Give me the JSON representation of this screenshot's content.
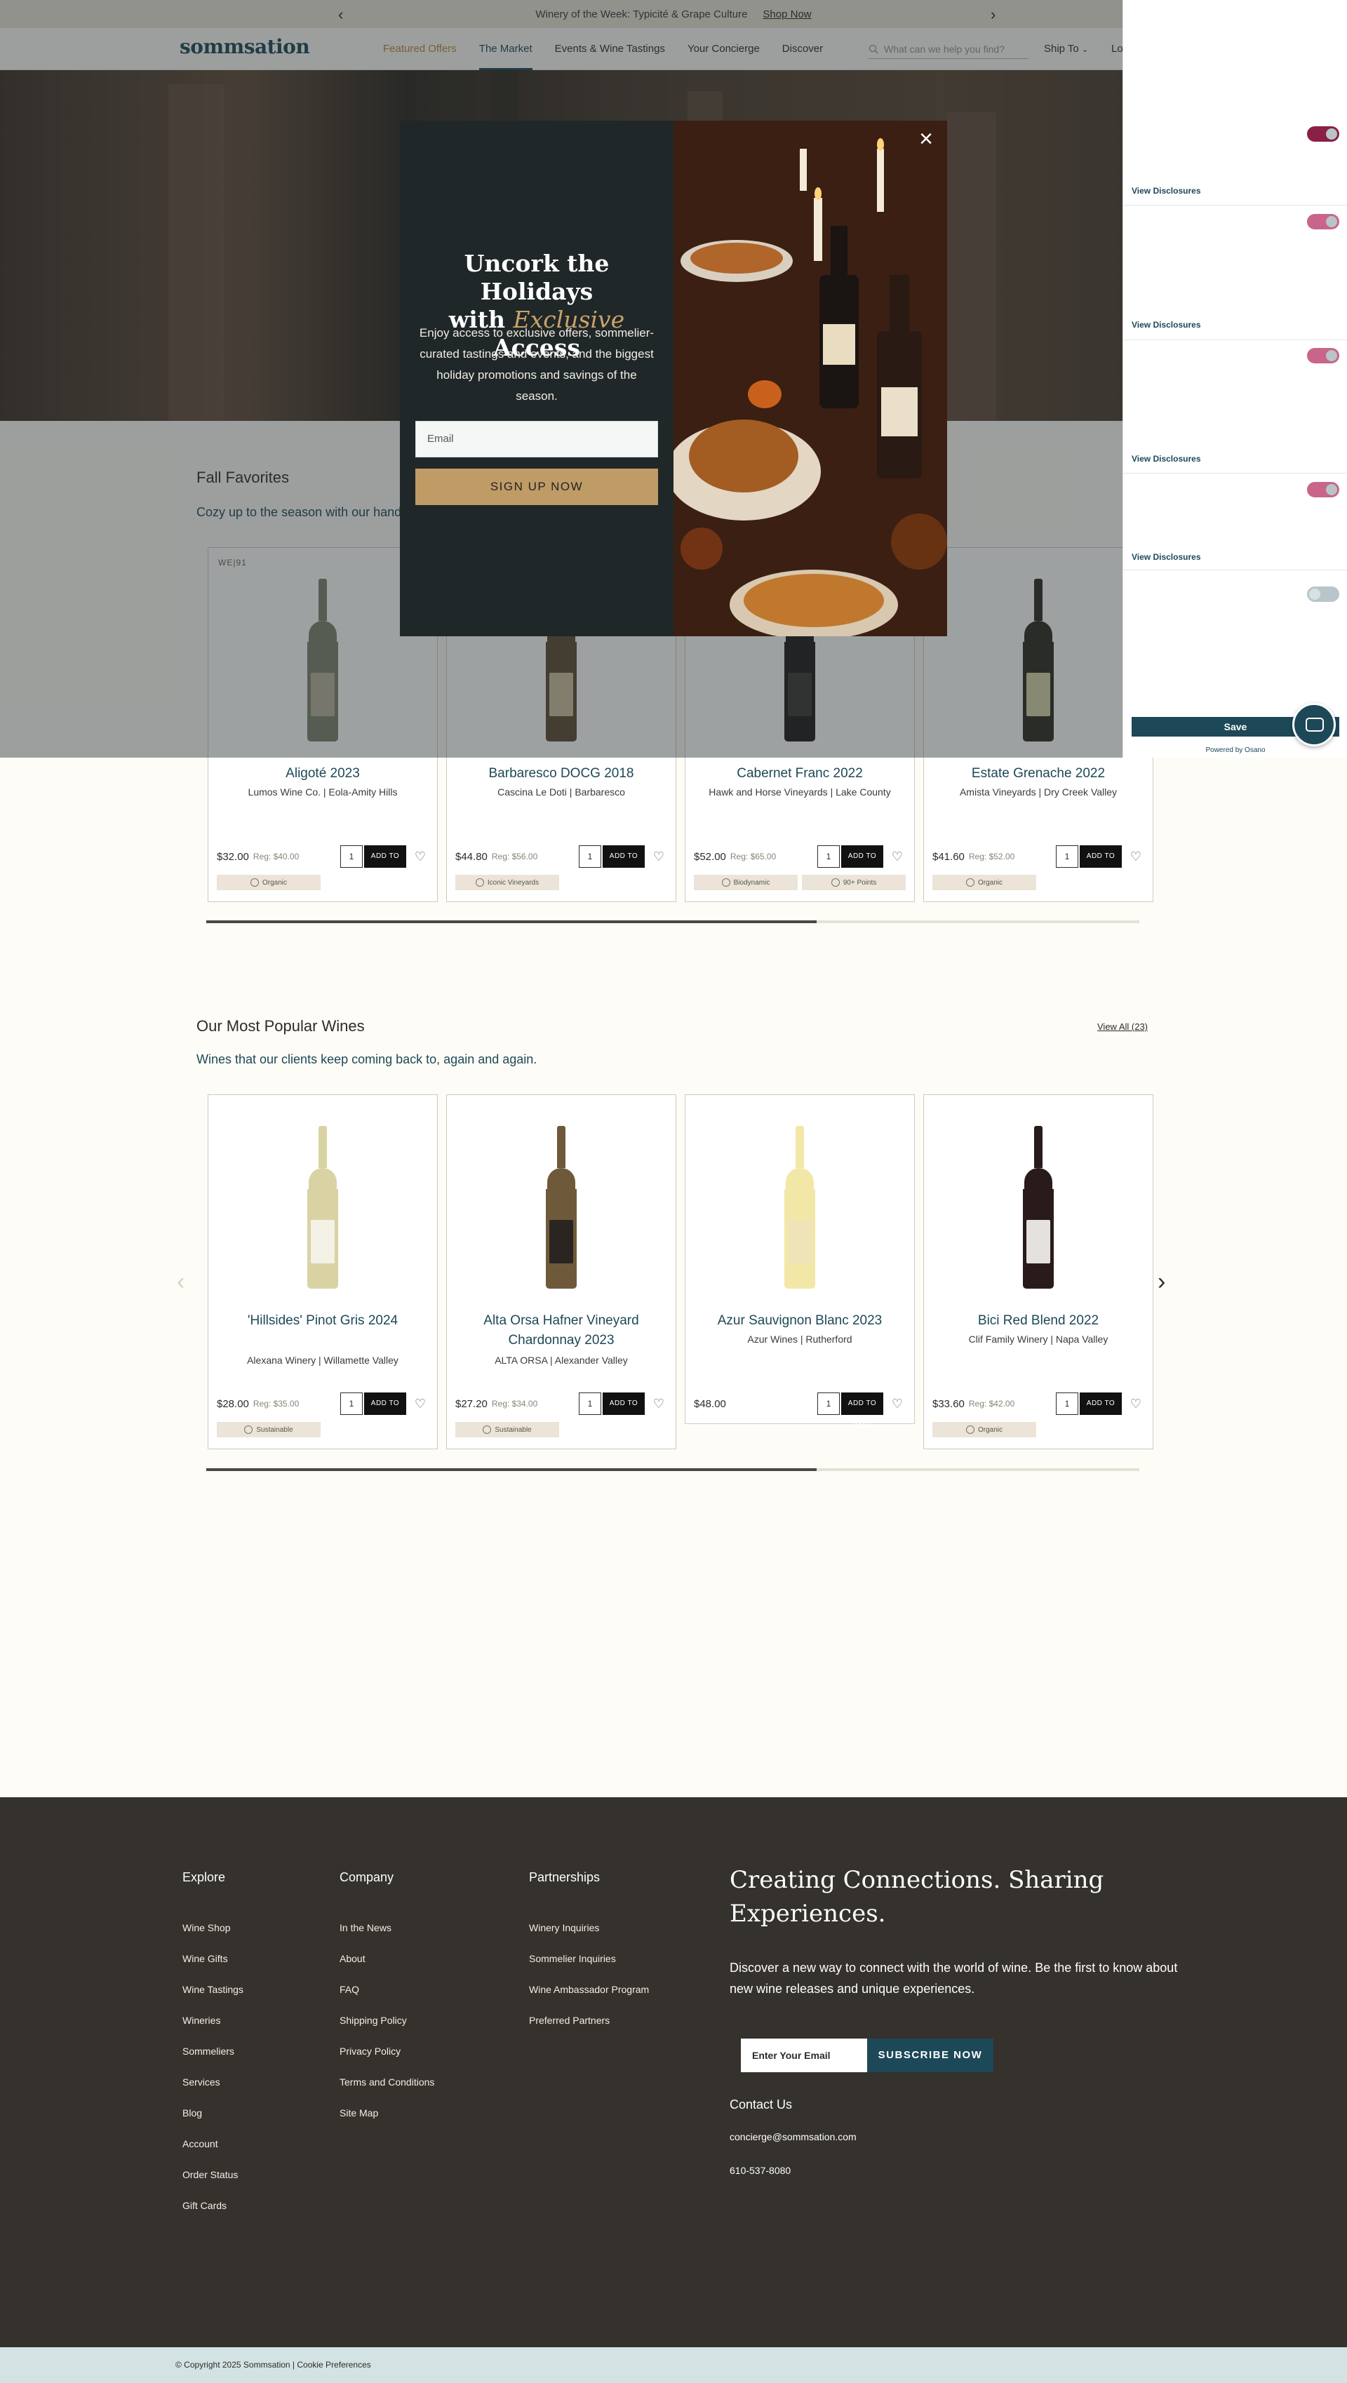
{
  "announcement": {
    "message": "Winery of the Week: Typicité & Grape Culture",
    "link": "Shop Now"
  },
  "header": {
    "logo": "sommsation",
    "nav": [
      "Featured Offers",
      "The Market",
      "Events & Wine Tastings",
      "Your Concierge",
      "Discover"
    ],
    "search_placeholder": "What can we help you find?",
    "ship_to": "Ship To",
    "login": "Lo"
  },
  "fall": {
    "title": "Fall Favorites",
    "subtitle": "Cozy up to the season with our hand",
    "products": [
      {
        "badge": "WE|91",
        "name": "Aligoté 2023",
        "producer": "Lumos Wine Co. | Eola-Amity Hills",
        "price": "$32.00",
        "reg": "Reg: $40.00",
        "qty": "1",
        "tags": [
          "Organic"
        ]
      },
      {
        "badge": "",
        "name": "Barbaresco DOCG 2018",
        "producer": "Cascina Le Doti | Barbaresco",
        "price": "$44.80",
        "reg": "Reg: $56.00",
        "qty": "1",
        "tags": [
          "Iconic Vineyards"
        ]
      },
      {
        "badge": "",
        "name": "Cabernet Franc 2022",
        "producer": "Hawk and Horse Vineyards | Lake County",
        "price": "$52.00",
        "reg": "Reg: $65.00",
        "qty": "1",
        "tags": [
          "Biodynamic",
          "90+ Points"
        ]
      },
      {
        "badge": "",
        "name": "Estate Grenache 2022",
        "producer": "Amista Vineyards | Dry Creek Valley",
        "price": "$41.60",
        "reg": "Reg: $52.00",
        "qty": "1",
        "tags": [
          "Organic"
        ]
      }
    ]
  },
  "popular": {
    "title": "Our Most Popular Wines",
    "subtitle": "Wines that our clients keep coming back to, again and again.",
    "view_all": "View All (23)",
    "products": [
      {
        "name": "'Hillsides' Pinot Gris 2024",
        "producer": "Alexana Winery | Willamette Valley",
        "price": "$28.00",
        "reg": "Reg: $35.00",
        "qty": "1",
        "tags": [
          "Sustainable"
        ]
      },
      {
        "name": "Alta Orsa Hafner Vineyard Chardonnay 2023",
        "producer": "ALTA ORSA | Alexander Valley",
        "price": "$27.20",
        "reg": "Reg: $34.00",
        "qty": "1",
        "tags": [
          "Sustainable"
        ]
      },
      {
        "name": "Azur Sauvignon Blanc 2023",
        "producer": "Azur Wines | Rutherford",
        "price": "$48.00",
        "reg": "",
        "qty": "1",
        "tags": []
      },
      {
        "name": "Bici Red Blend 2022",
        "producer": "Clif Family Winery | Napa Valley",
        "price": "$33.60",
        "reg": "Reg: $42.00",
        "qty": "1",
        "tags": [
          "Organic"
        ]
      }
    ]
  },
  "add_to_cart": "ADD TO CART",
  "modal": {
    "title_line1": "Uncork the Holidays",
    "title_with": "with",
    "title_emphasis": "Exclusive",
    "title_end": "Access",
    "body": "Enjoy access to exclusive offers, sommelier-curated tastings and events, and the biggest holiday promotions and savings of the season.",
    "email_placeholder": "Email",
    "signup": "SIGN UP NOW"
  },
  "cookie": {
    "view_disclosures": "View Disclosures",
    "save": "Save",
    "powered_by": "Powered by Osano"
  },
  "footer": {
    "explore": {
      "title": "Explore",
      "links": [
        "Wine Shop",
        "Wine Gifts",
        "Wine Tastings",
        "Wineries",
        "Sommeliers",
        "Services",
        "Blog",
        "Account",
        "Order Status",
        "Gift Cards"
      ]
    },
    "company": {
      "title": "Company",
      "links": [
        "In the News",
        "About",
        "FAQ",
        "Shipping Policy",
        "Privacy Policy",
        "Terms and Conditions",
        "Site Map"
      ]
    },
    "partnerships": {
      "title": "Partnerships",
      "links": [
        "Winery Inquiries",
        "Sommelier Inquiries",
        "Wine Ambassador Program",
        "Preferred Partners"
      ]
    },
    "headline": "Creating Connections. Sharing Experiences.",
    "text": "Discover a new way to connect with the world of wine. Be the first to know about new wine releases and unique experiences.",
    "email_placeholder": "Enter Your Email",
    "subscribe": "SUBSCRIBE NOW",
    "contact_title": "Contact Us",
    "contact_email": "concierge@sommsation.com",
    "contact_phone": "610-537-8080"
  },
  "copyright": "© Copyright 2025 Sommsation | Cookie Preferences",
  "colors": {
    "brand": "#1d4857",
    "accent": "#b8893a",
    "footer": "#35312c",
    "signup": "#bf9b66"
  }
}
